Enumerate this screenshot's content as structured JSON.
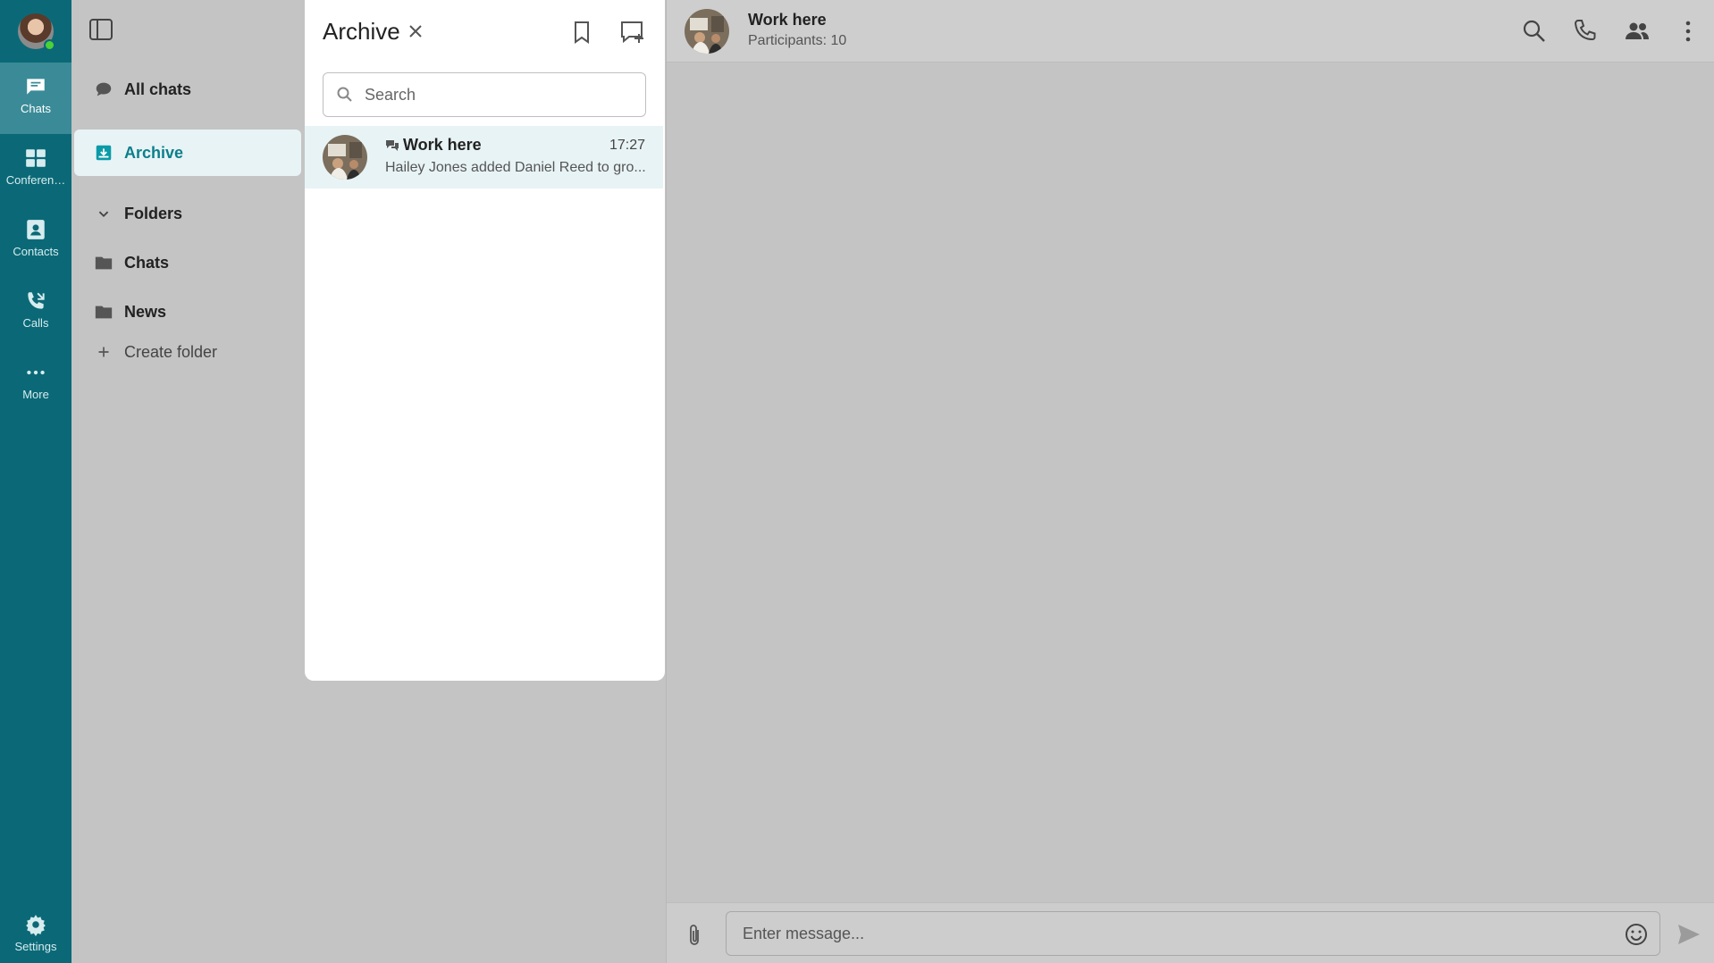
{
  "rail": {
    "items": [
      {
        "label": "Chats",
        "icon": "chat-bubble-icon",
        "active": true
      },
      {
        "label": "Conferen…",
        "icon": "conference-icon",
        "active": false
      },
      {
        "label": "Contacts",
        "icon": "contacts-icon",
        "active": false
      },
      {
        "label": "Calls",
        "icon": "calls-icon",
        "active": false
      },
      {
        "label": "More",
        "icon": "more-dots-icon",
        "active": false
      }
    ],
    "settings_label": "Settings",
    "accent": "#0b6977",
    "online_color": "#4cd137"
  },
  "folders": {
    "all_chats": "All chats",
    "archive": "Archive",
    "folders_header": "Folders",
    "items": [
      {
        "label": "Chats"
      },
      {
        "label": "News"
      }
    ],
    "create_folder": "Create folder"
  },
  "archive": {
    "title": "Archive",
    "search_placeholder": "Search",
    "chats": [
      {
        "name": "Work here",
        "time": "17:27",
        "preview": "Hailey Jones added Daniel Reed to gro..."
      }
    ],
    "highlight_color": "#e8f3f5"
  },
  "chat": {
    "title": "Work here",
    "subtitle": "Participants: 10",
    "message_placeholder": "Enter message..."
  }
}
